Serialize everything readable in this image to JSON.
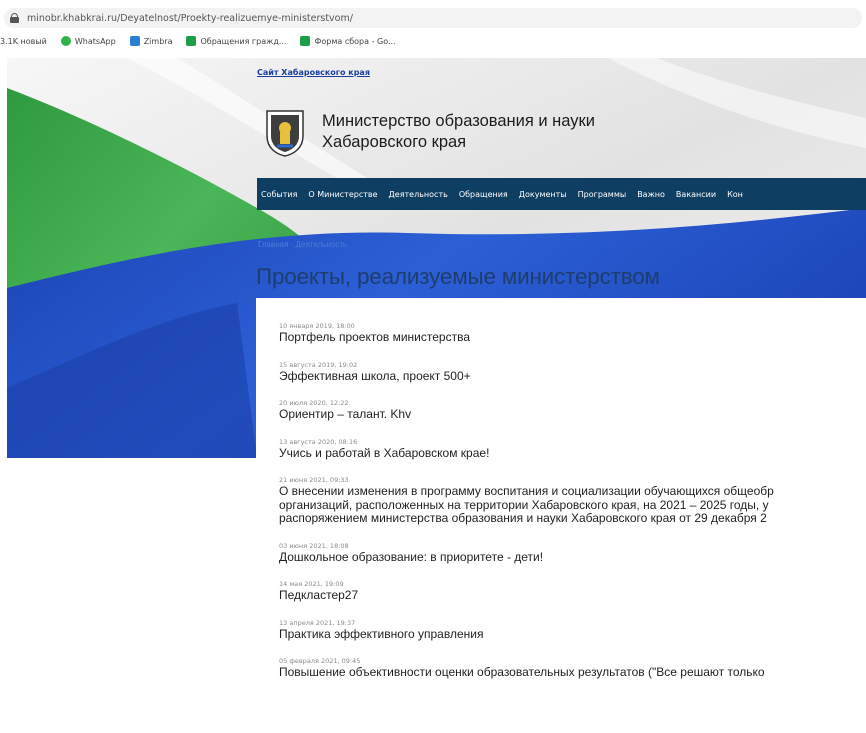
{
  "browser": {
    "url": "minobr.khabkrai.ru/Deyatelnost/Proekty-realizuemye-ministerstvom/",
    "bookmarks": [
      {
        "label": "3.1K новый",
        "icon": "none"
      },
      {
        "label": "WhatsApp",
        "icon": "whatsapp-icon"
      },
      {
        "label": "Zimbra",
        "icon": "zimbra-icon"
      },
      {
        "label": "Обращения гражд...",
        "icon": "sheet-icon"
      },
      {
        "label": "Форма сбора - Go...",
        "icon": "sheet-icon"
      }
    ]
  },
  "header": {
    "site_link": "Сайт Хабаровского края",
    "ministry_line1": "Министерство образования и науки",
    "ministry_line2": "Хабаровского края",
    "logo_icon": "coat-of-arms-icon"
  },
  "nav": {
    "items": [
      "События",
      "О Министерстве",
      "Деятельность",
      "Обращения",
      "Документы",
      "Программы",
      "Важно",
      "Вакансии",
      "Кон"
    ]
  },
  "breadcrumb": "Главная · Деятельность",
  "page_title": "Проекты, реализуемые министерством",
  "news": [
    {
      "date": "10 января 2019, 18:00",
      "title": "Портфель проектов министерства"
    },
    {
      "date": "15 августа 2019, 19:02",
      "title": "Эффективная школа, проект 500+"
    },
    {
      "date": "20 июля 2020, 12:22",
      "title": "Ориентир – талант. Khv"
    },
    {
      "date": "13 августа 2020, 08:16",
      "title": "Учись и работай в Хабаровском крае!"
    },
    {
      "date": "21 июня 2021, 09:33",
      "title_lines": [
        "О внесении изменения в программу воспитания и социализации обучающихся общеобр",
        "организаций, расположенных на территории Хабаровского края, на 2021 – 2025 годы, у",
        "распоряжением министерства образования и науки Хабаровского края от 29 декабря 2"
      ]
    },
    {
      "date": "03 июня 2021, 18:08",
      "title": "Дошкольное образование: в приоритете - дети!"
    },
    {
      "date": "14 мая 2021, 19:09",
      "title": "Педкластер27"
    },
    {
      "date": "13 апреля 2021, 19:37",
      "title": "Практика эффективного управления"
    },
    {
      "date": "05 февраля 2021, 09:45",
      "title": "Повышение объективности оценки образовательных результатов (\"Все решают только"
    }
  ],
  "colors": {
    "nav_bg": "#0f3e63",
    "flag_green": "#3aa647",
    "flag_blue": "#2553c8",
    "title_color": "#1e3d6e"
  }
}
